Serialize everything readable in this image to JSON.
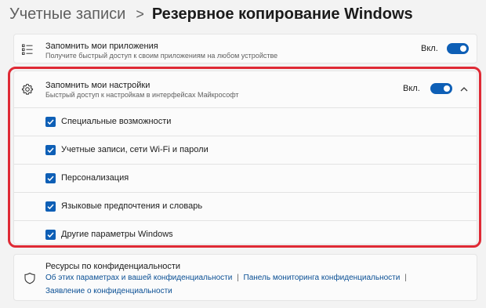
{
  "breadcrumb": {
    "parent": "Учетные записи",
    "separator": ">",
    "current": "Резервное копирование Windows"
  },
  "apps_card": {
    "title": "Запомнить мои приложения",
    "subtitle": "Получите быстрый доступ к своим приложениям на любом устройстве",
    "state_label": "Вкл.",
    "toggle_on": true,
    "icon": "apps-list-icon"
  },
  "settings_card": {
    "title": "Запомнить мои настройки",
    "subtitle": "Быстрый доступ к настройкам в интерфейсах Майкрософт",
    "state_label": "Вкл.",
    "toggle_on": true,
    "icon": "gear-icon",
    "expanded": true,
    "options": [
      {
        "label": "Специальные возможности",
        "checked": true
      },
      {
        "label": "Учетные записи, сети Wi-Fi и пароли",
        "checked": true
      },
      {
        "label": "Персонализация",
        "checked": true
      },
      {
        "label": "Языковые предпочтения и словарь",
        "checked": true
      },
      {
        "label": "Другие параметры Windows",
        "checked": true
      }
    ]
  },
  "resources_card": {
    "title": "Ресурсы по конфиденциальности",
    "icon": "shield-icon",
    "link1": "Об этих параметрах и вашей конфиденциальности",
    "link2": "Панель мониторинга конфиденциальности",
    "link3": "Заявление о конфиденциальности",
    "separator": "|"
  },
  "colors": {
    "accent": "#0e5fb6",
    "highlight_border": "#df2a35",
    "link": "#0a4f94",
    "background": "#f3f3f3",
    "card": "#fbfbfb"
  }
}
